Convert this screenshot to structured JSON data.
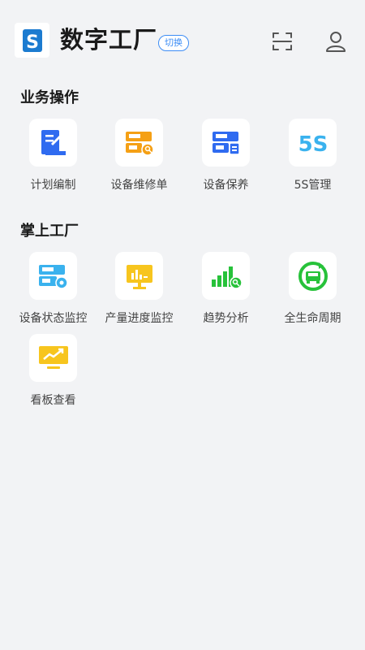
{
  "header": {
    "title": "数字工厂",
    "switch_label": "切换",
    "logo_letter": "S"
  },
  "sections": [
    {
      "title": "业务操作",
      "items": [
        {
          "label": "计划编制",
          "icon": "plan-document-icon"
        },
        {
          "label": "设备维修单",
          "icon": "equipment-repair-icon"
        },
        {
          "label": "设备保养",
          "icon": "equipment-maintenance-icon"
        },
        {
          "label": "5S管理",
          "icon": "5s-management-icon",
          "icon_text": "5S"
        }
      ]
    },
    {
      "title": "掌上工厂",
      "items": [
        {
          "label": "设备状态监控",
          "icon": "equipment-status-monitor-icon"
        },
        {
          "label": "产量进度监控",
          "icon": "output-progress-monitor-icon"
        },
        {
          "label": "趋势分析",
          "icon": "trend-analysis-icon"
        },
        {
          "label": "全生命周期",
          "icon": "lifecycle-icon"
        },
        {
          "label": "看板查看",
          "icon": "dashboard-view-icon"
        }
      ]
    }
  ],
  "colors": {
    "blue": "#2f6bf0",
    "orange": "#f5a015",
    "cyan": "#3ab2ee",
    "yellow": "#f7c51e",
    "green": "#27c23a"
  }
}
